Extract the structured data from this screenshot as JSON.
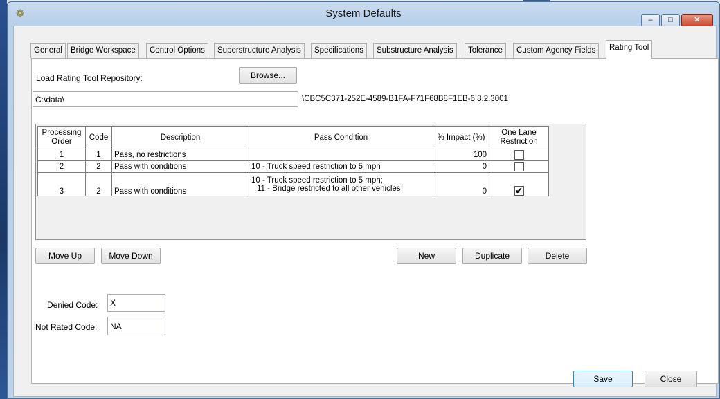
{
  "window": {
    "title": "System Defaults",
    "minimize_glyph": "–",
    "maximize_glyph": "□",
    "close_glyph": "✕",
    "app_icon_glyph": "❁"
  },
  "tabs": [
    {
      "label": "General"
    },
    {
      "label": "Bridge Workspace"
    },
    {
      "label": "Control Options"
    },
    {
      "label": "Superstructure Analysis"
    },
    {
      "label": "Specifications"
    },
    {
      "label": "Substructure Analysis"
    },
    {
      "label": "Tolerance"
    },
    {
      "label": "Custom Agency Fields"
    },
    {
      "label": "Rating Tool",
      "active": true
    }
  ],
  "repository": {
    "label": "Load Rating Tool Repository:",
    "browse_label": "Browse...",
    "path_value": "C:\\data\\",
    "suffix": "\\CBC5C371-252E-4589-B1FA-F71F68B8F1EB-6.8.2.3001"
  },
  "table": {
    "headers": {
      "processing_order": "Processing Order",
      "code": "Code",
      "description": "Description",
      "pass_condition": "Pass Condition",
      "impact": "% Impact (%)",
      "one_lane": "One Lane Restriction"
    },
    "rows": [
      {
        "order": "1",
        "code": "1",
        "description": "Pass, no restrictions",
        "condition_1": "",
        "condition_2": "",
        "impact": "100",
        "one_lane": false
      },
      {
        "order": "2",
        "code": "2",
        "description": "Pass with conditions",
        "condition_1": "10 - Truck speed restriction to 5 mph",
        "condition_2": "",
        "impact": "0",
        "one_lane": false
      },
      {
        "order": "3",
        "code": "2",
        "description": "Pass with conditions",
        "condition_1": "10 - Truck speed restriction to 5 mph;",
        "condition_2": "11 - Bridge restricted to all other vehicles",
        "impact": "0",
        "one_lane": true
      }
    ]
  },
  "buttons": {
    "move_up": "Move Up",
    "move_down": "Move Down",
    "new": "New",
    "duplicate": "Duplicate",
    "delete": "Delete",
    "save": "Save",
    "close": "Close"
  },
  "codes": {
    "denied_label": "Denied Code:",
    "denied_value": "X",
    "not_rated_label": "Not Rated Code:",
    "not_rated_value": "NA"
  },
  "checkmark_glyph": "✔"
}
